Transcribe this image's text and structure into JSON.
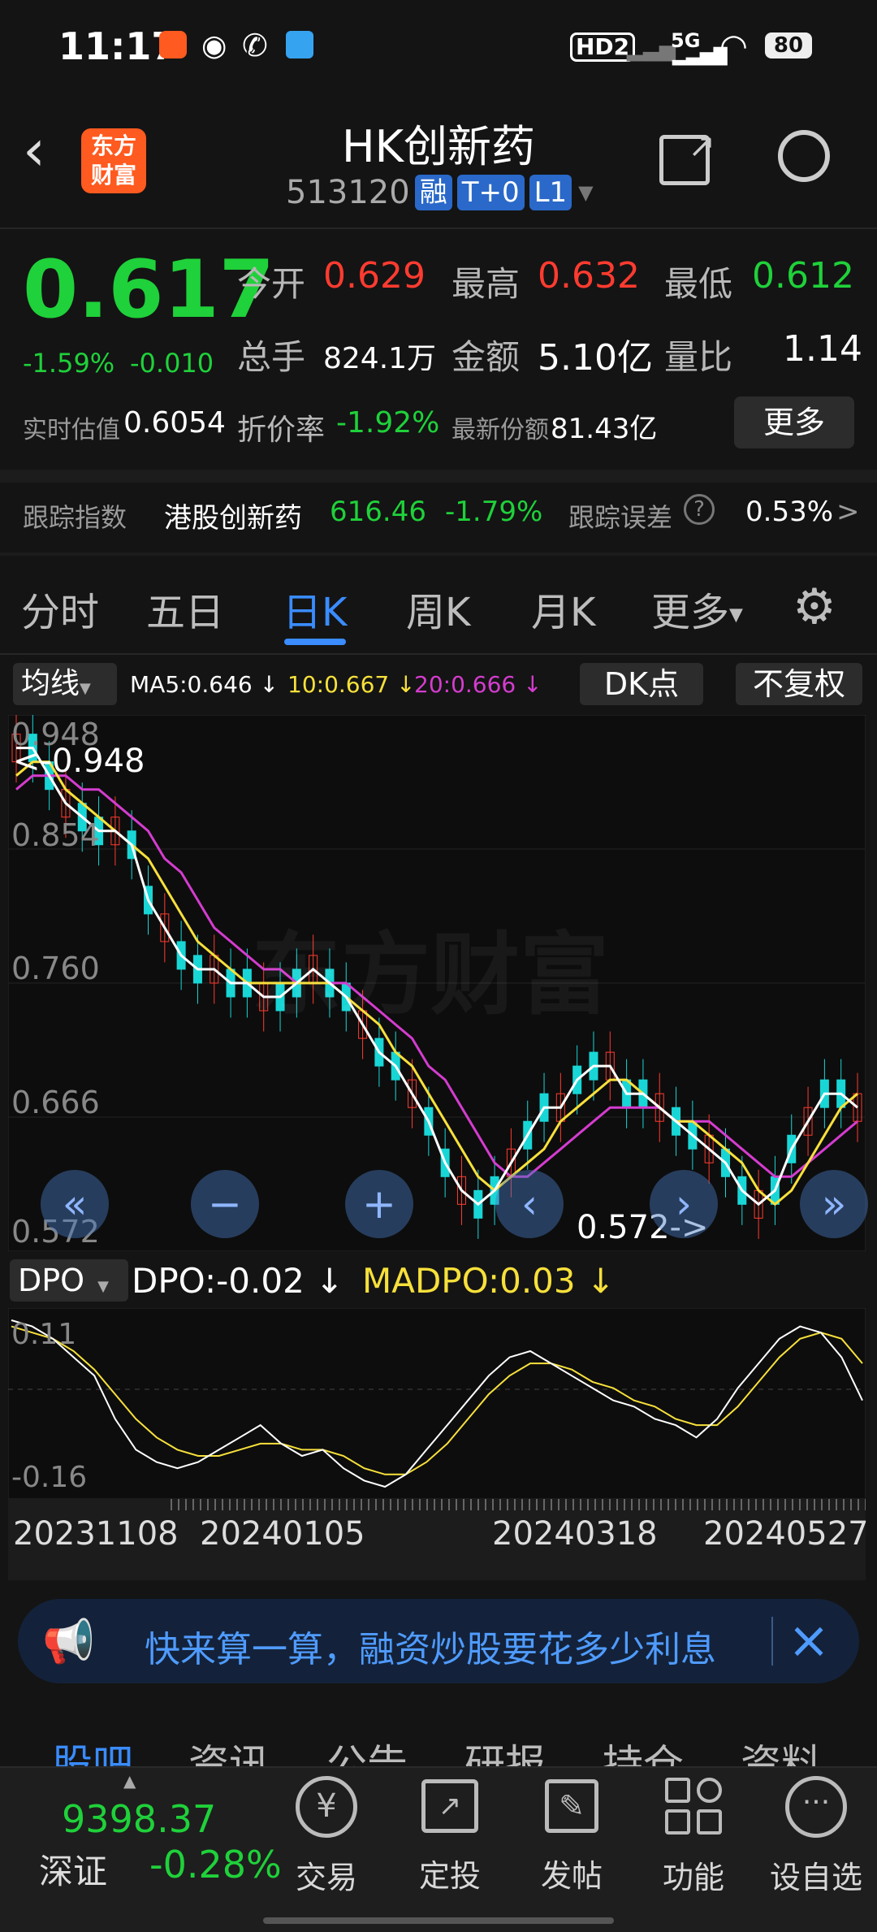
{
  "status_bar": {
    "time": "11:17",
    "battery": "80",
    "network": "5G",
    "hd": "HD2"
  },
  "header": {
    "title": "HK创新药",
    "code": "513120",
    "badges": [
      "融",
      "T+0",
      "L1"
    ],
    "logo_text_1": "东方",
    "logo_text_2": "财富"
  },
  "quote": {
    "price": "0.617",
    "change_pct": "-1.59%",
    "change": "-0.010",
    "open_label": "今开",
    "open": "0.629",
    "high_label": "最高",
    "high": "0.632",
    "low_label": "最低",
    "low": "0.612",
    "volume_label": "总手",
    "volume": "824.1万",
    "amount_label": "金额",
    "amount": "5.10亿",
    "ratio_label": "量比",
    "ratio": "1.14",
    "iopv_label": "实时估值",
    "iopv": "0.6054",
    "discount_label": "折价率",
    "discount": "-1.92%",
    "shares_label": "最新份额",
    "shares": "81.43亿",
    "more_button": "更多"
  },
  "tracking": {
    "label": "跟踪指数",
    "index_name": "港股创新药",
    "index_value": "616.46",
    "index_change": "-1.79%",
    "error_label": "跟踪误差",
    "error_value": "0.53%",
    "arrow": ">"
  },
  "chart_tabs": [
    "分时",
    "五日",
    "日K",
    "周K",
    "月K",
    "更多"
  ],
  "active_tab": "日K",
  "ma_bar": {
    "selector": "均线",
    "ma5": "MA5:0.646 ↓",
    "ma10": "10:0.667 ↓",
    "ma20": "20:0.666 ↓",
    "dk_button": "DK点",
    "fq_button": "不复权"
  },
  "kchart_labels": {
    "y_top": "0.948",
    "y2": "0.854",
    "y3": "0.760",
    "y4": "0.666",
    "y_bottom": "0.572",
    "max_marker": "<-0.948",
    "min_marker": "0.572->",
    "watermark": "东方财富"
  },
  "dpo_bar": {
    "selector": "DPO",
    "dpo": "DPO:-0.02 ↓",
    "madpo": "MADPO:0.03 ↓",
    "y_top": "0.11",
    "y_bottom": "-0.16"
  },
  "dates": [
    "20231108",
    "20240105",
    "20240318",
    "20240527"
  ],
  "banner": {
    "text": "快来算一算，融资炒股要花多少利息"
  },
  "info_tabs": [
    "股吧",
    "资讯",
    "公告",
    "研报",
    "持仓",
    "资料"
  ],
  "bottom_bar": {
    "index_value": "9398.37",
    "index_name": "深证",
    "index_change": "-0.28%",
    "items": [
      {
        "label": "交易",
        "icon": "yen-icon"
      },
      {
        "label": "定投",
        "icon": "chart-board-icon"
      },
      {
        "label": "发帖",
        "icon": "edit-icon"
      },
      {
        "label": "功能",
        "icon": "grid-icon"
      },
      {
        "label": "设自选",
        "icon": "more-dots-icon"
      }
    ]
  },
  "colors": {
    "up": "#ff3b30",
    "down": "#1fd13a",
    "accent": "#2a69c9",
    "ma5": "#ffffff",
    "ma10": "#f7e03b",
    "ma20": "#d43ccf"
  },
  "chart_data": {
    "type": "candlestick",
    "ylim": [
      0.572,
      0.948
    ],
    "ma5": [
      0.93,
      0.93,
      0.91,
      0.89,
      0.88,
      0.87,
      0.87,
      0.86,
      0.82,
      0.8,
      0.78,
      0.77,
      0.77,
      0.76,
      0.76,
      0.75,
      0.75,
      0.76,
      0.77,
      0.76,
      0.75,
      0.73,
      0.71,
      0.7,
      0.68,
      0.66,
      0.63,
      0.61,
      0.6,
      0.61,
      0.63,
      0.65,
      0.67,
      0.67,
      0.69,
      0.7,
      0.7,
      0.68,
      0.68,
      0.67,
      0.66,
      0.65,
      0.64,
      0.63,
      0.61,
      0.6,
      0.61,
      0.64,
      0.66,
      0.68,
      0.68,
      0.67
    ],
    "ma10": [
      0.91,
      0.92,
      0.92,
      0.9,
      0.89,
      0.88,
      0.87,
      0.86,
      0.85,
      0.83,
      0.81,
      0.79,
      0.78,
      0.77,
      0.76,
      0.76,
      0.76,
      0.76,
      0.76,
      0.76,
      0.75,
      0.74,
      0.73,
      0.71,
      0.7,
      0.68,
      0.66,
      0.64,
      0.62,
      0.61,
      0.62,
      0.63,
      0.64,
      0.66,
      0.67,
      0.68,
      0.69,
      0.69,
      0.68,
      0.67,
      0.66,
      0.66,
      0.65,
      0.64,
      0.63,
      0.61,
      0.6,
      0.61,
      0.63,
      0.65,
      0.67,
      0.68
    ],
    "ma20": [
      0.9,
      0.91,
      0.91,
      0.91,
      0.9,
      0.9,
      0.89,
      0.88,
      0.87,
      0.85,
      0.84,
      0.82,
      0.8,
      0.79,
      0.78,
      0.77,
      0.77,
      0.76,
      0.76,
      0.76,
      0.76,
      0.75,
      0.74,
      0.73,
      0.72,
      0.7,
      0.69,
      0.67,
      0.65,
      0.63,
      0.62,
      0.62,
      0.63,
      0.64,
      0.65,
      0.66,
      0.67,
      0.67,
      0.67,
      0.67,
      0.66,
      0.66,
      0.66,
      0.65,
      0.64,
      0.63,
      0.62,
      0.62,
      0.63,
      0.64,
      0.65,
      0.66
    ],
    "dpo": [
      0.11,
      0.1,
      0.08,
      0.05,
      0.02,
      -0.05,
      -0.1,
      -0.12,
      -0.13,
      -0.12,
      -0.1,
      -0.08,
      -0.06,
      -0.09,
      -0.11,
      -0.1,
      -0.13,
      -0.15,
      -0.16,
      -0.14,
      -0.1,
      -0.06,
      -0.02,
      0.02,
      0.05,
      0.06,
      0.04,
      0.02,
      0.0,
      -0.02,
      -0.03,
      -0.05,
      -0.06,
      -0.08,
      -0.05,
      0.0,
      0.04,
      0.08,
      0.1,
      0.09,
      0.05,
      -0.02
    ],
    "madpo": [
      0.1,
      0.09,
      0.08,
      0.06,
      0.03,
      -0.01,
      -0.05,
      -0.08,
      -0.1,
      -0.11,
      -0.11,
      -0.1,
      -0.09,
      -0.09,
      -0.1,
      -0.1,
      -0.11,
      -0.13,
      -0.14,
      -0.14,
      -0.12,
      -0.09,
      -0.05,
      -0.01,
      0.02,
      0.04,
      0.04,
      0.03,
      0.01,
      0.0,
      -0.02,
      -0.03,
      -0.05,
      -0.06,
      -0.06,
      -0.03,
      0.01,
      0.05,
      0.08,
      0.09,
      0.08,
      0.04
    ],
    "dpo_ylim": [
      -0.16,
      0.11
    ]
  }
}
